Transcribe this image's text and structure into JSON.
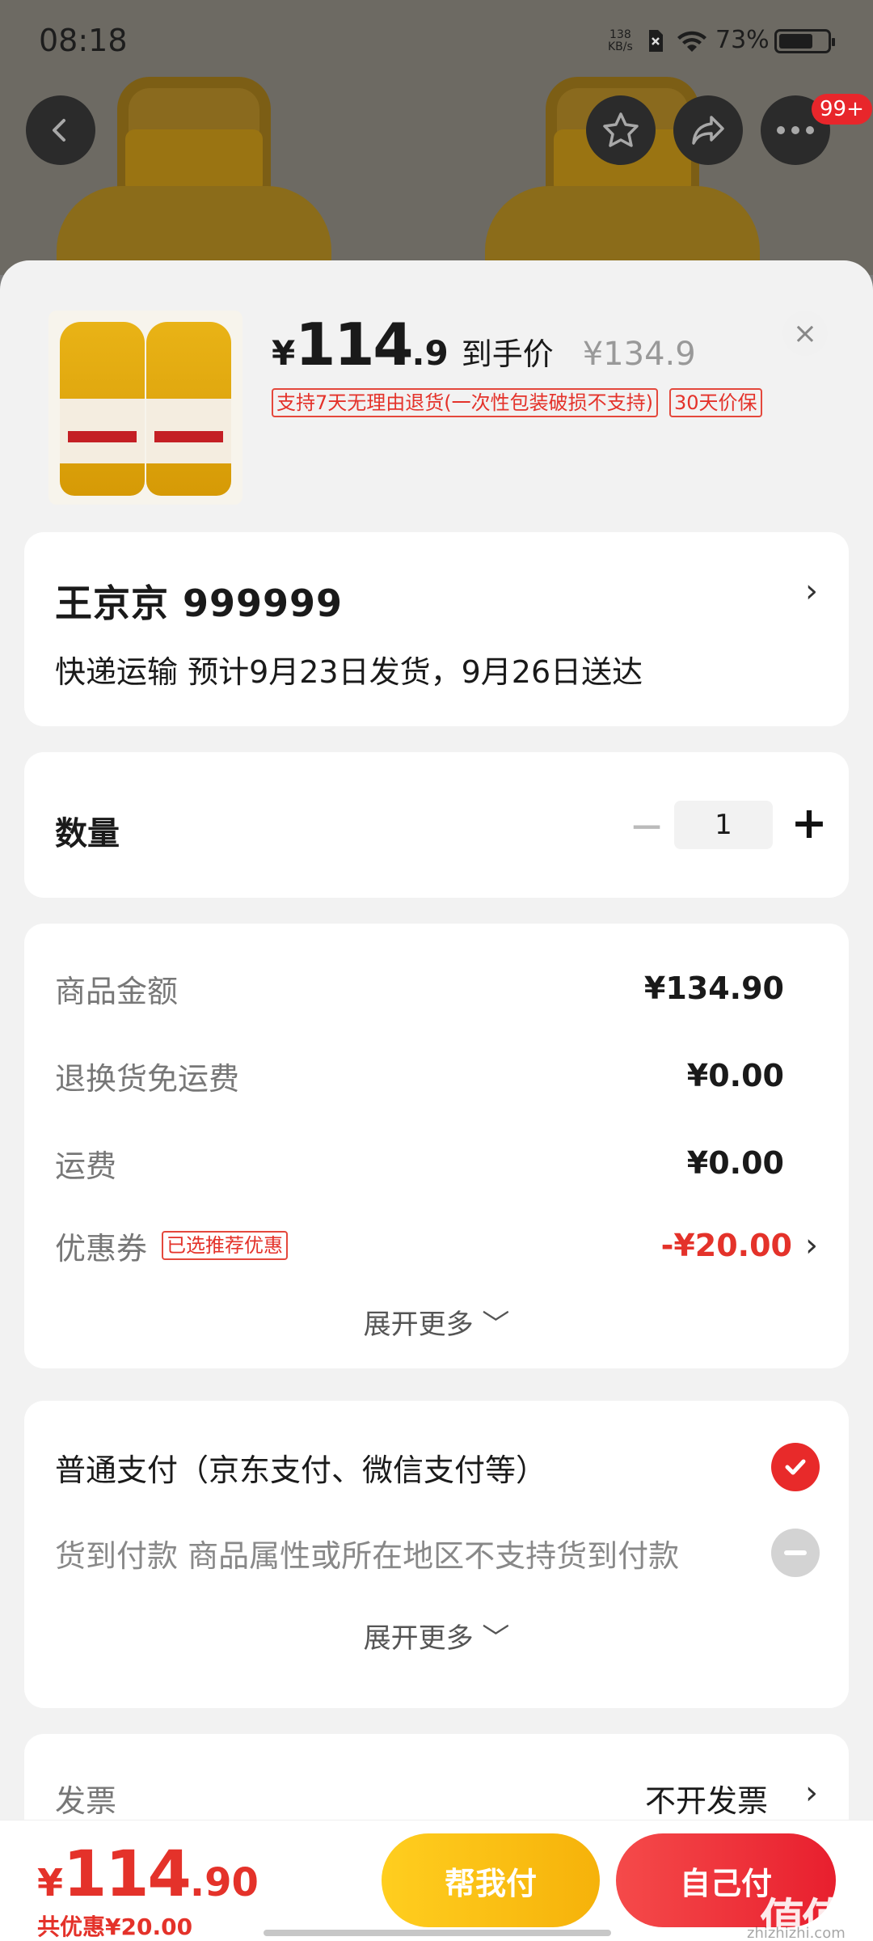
{
  "status_bar": {
    "time": "08:18",
    "net_speed_value": "138",
    "net_speed_unit": "KB/s",
    "battery_percent": "73%",
    "battery_level": 0.73
  },
  "top_nav": {
    "badge_count": "99+"
  },
  "product": {
    "price_currency": "¥",
    "price_integer": "114",
    "price_decimal": ".9",
    "price_suffix": "到手价",
    "original_price": "¥134.9",
    "tags": [
      "支持7天无理由退货(一次性包装破损不支持)",
      "30天价保"
    ],
    "close_symbol": "×"
  },
  "address": {
    "name_phone": "王京京  999999",
    "shipping": "快递运输 预计9月23日发货，9月26日送达",
    "chevron": "›"
  },
  "quantity": {
    "label": "数量",
    "value": "1",
    "minus": "−",
    "plus": "+"
  },
  "fees": {
    "rows": [
      {
        "label": "商品金额",
        "value": "¥134.90"
      },
      {
        "label": "退换货免运费",
        "value": "¥0.00"
      },
      {
        "label": "运费",
        "value": "¥0.00"
      },
      {
        "label": "优惠券",
        "tag": "已选推荐优惠",
        "value": "-¥20.00"
      }
    ],
    "expand": "展开更多 ﹀"
  },
  "payment": {
    "options": [
      {
        "label": "普通支付（京东支付、微信支付等）",
        "selected": true
      },
      {
        "label": "货到付款   商品属性或所在地区不支持货到付款",
        "selected": false
      }
    ],
    "expand": "展开更多 ﹀"
  },
  "invoice": {
    "label": "发票",
    "value": "不开发票",
    "chevron": "›"
  },
  "bottom_bar": {
    "total_currency": "¥",
    "total_integer": "114",
    "total_decimal": ".90",
    "saved": "共优惠¥20.00",
    "help_pay": "帮我付",
    "self_pay": "自己付"
  },
  "watermark": {
    "text": "值值值",
    "sub": "zhizhizhi.com"
  },
  "colors": {
    "accent_red": "#e4322a",
    "help_yellow": "#f6b20a",
    "pay_red": "#e81f2e"
  }
}
